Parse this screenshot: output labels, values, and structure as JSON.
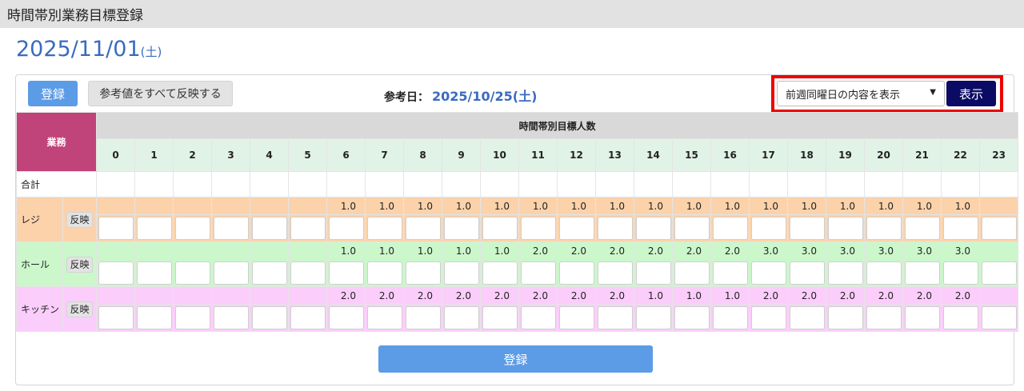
{
  "page_title": "時間帯別業務目標登録",
  "date": {
    "main": "2025/11/01",
    "dow": "(土)"
  },
  "toolbar": {
    "register_label": "登録",
    "reflect_all_label": "参考値をすべて反映する",
    "ref_date_label": "参考日：",
    "ref_date_value": "2025/10/25(土)",
    "select_value": "前週同曜日の内容を表示",
    "show_label": "表示"
  },
  "table": {
    "task_header": "業務",
    "hours_header": "時間帯別目標人数",
    "hours": [
      "0",
      "1",
      "2",
      "3",
      "4",
      "5",
      "6",
      "7",
      "8",
      "9",
      "10",
      "11",
      "12",
      "13",
      "14",
      "15",
      "16",
      "17",
      "18",
      "19",
      "20",
      "21",
      "22",
      "23"
    ],
    "total_label": "合計",
    "reflect_label": "反映",
    "rows": [
      {
        "name": "レジ",
        "refs": [
          "",
          "",
          "",
          "",
          "",
          "",
          "1.0",
          "1.0",
          "1.0",
          "1.0",
          "1.0",
          "1.0",
          "1.0",
          "1.0",
          "1.0",
          "1.0",
          "1.0",
          "1.0",
          "1.0",
          "1.0",
          "1.0",
          "1.0",
          "1.0",
          ""
        ]
      },
      {
        "name": "ホール",
        "refs": [
          "",
          "",
          "",
          "",
          "",
          "",
          "1.0",
          "1.0",
          "1.0",
          "1.0",
          "1.0",
          "2.0",
          "2.0",
          "2.0",
          "2.0",
          "2.0",
          "2.0",
          "3.0",
          "3.0",
          "3.0",
          "3.0",
          "3.0",
          "3.0",
          ""
        ]
      },
      {
        "name": "キッチン",
        "refs": [
          "",
          "",
          "",
          "",
          "",
          "",
          "2.0",
          "2.0",
          "2.0",
          "2.0",
          "2.0",
          "2.0",
          "2.0",
          "2.0",
          "1.0",
          "1.0",
          "1.0",
          "2.0",
          "2.0",
          "2.0",
          "2.0",
          "2.0",
          "2.0",
          ""
        ]
      }
    ]
  },
  "footer": {
    "register_label": "登録"
  },
  "colors": {
    "accent_blue": "#5c9be5",
    "dark_navy": "#0b0a64",
    "highlight_red": "#ee0000",
    "task_header": "#c04379",
    "reji_bg": "#fcd2ab",
    "hall_bg": "#cbf7cb",
    "kitchen_bg": "#fbcdfb"
  },
  "icons": {
    "select_arrow": "caret-down-icon"
  }
}
